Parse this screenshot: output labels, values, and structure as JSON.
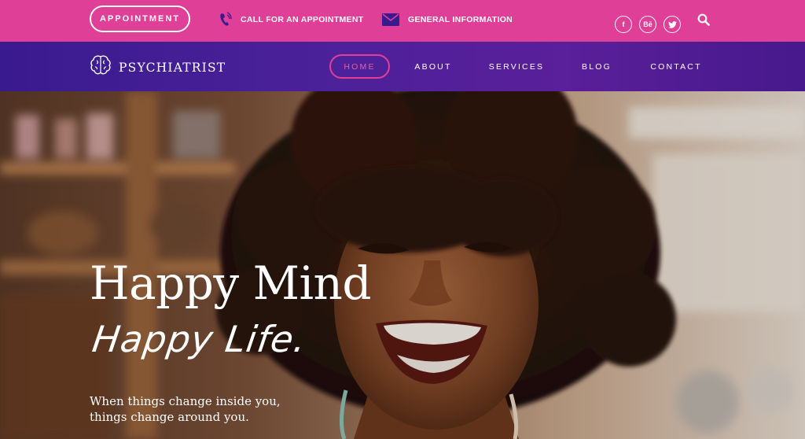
{
  "topbar": {
    "appointment_button": "APPOINTMENT",
    "call_text": "CALL FOR AN APPOINTMENT",
    "info_text": "GENERAL INFORMATION",
    "social": {
      "facebook": "f",
      "behance": "Bē",
      "twitter": "t"
    },
    "icons": [
      "phone-icon",
      "envelope-icon",
      "facebook-icon",
      "behance-icon",
      "twitter-icon",
      "search-icon"
    ],
    "background": "#e03f98"
  },
  "navbar": {
    "logo_text": "PSYCHIATRIST",
    "items": [
      {
        "label": "HOME",
        "active": true
      },
      {
        "label": "ABOUT"
      },
      {
        "label": "SERVICES"
      },
      {
        "label": "BLOG"
      },
      {
        "label": "CONTACT"
      }
    ],
    "background": "#4b2199",
    "accent": "#e03f98"
  },
  "hero": {
    "title_line1": "Happy Mind",
    "title_line2": "Happy Life.",
    "tagline_line1": "When things change inside you,",
    "tagline_line2": "things change around you."
  }
}
